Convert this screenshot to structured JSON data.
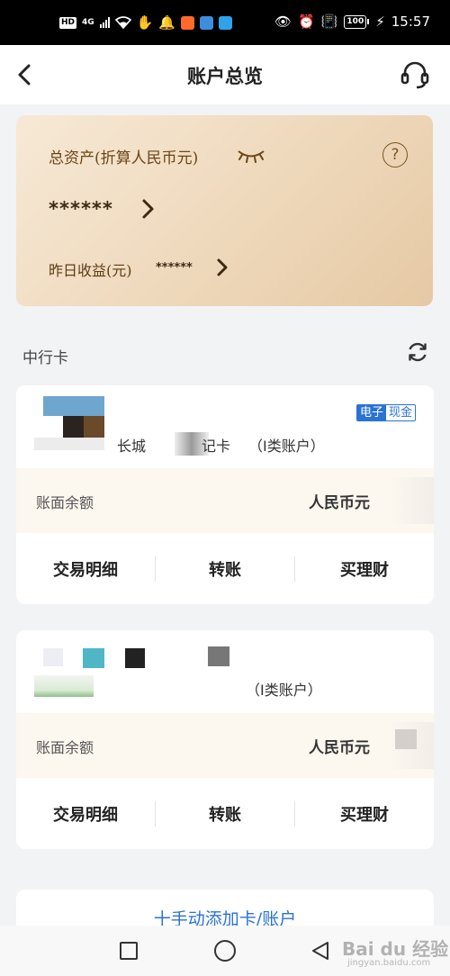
{
  "status_bar": {
    "hd": "HD",
    "network": "4G",
    "battery": "100",
    "time": "15:57"
  },
  "header": {
    "title": "账户总览"
  },
  "asset_card": {
    "total_assets_label": "总资产(折算人民币元)",
    "total_assets_value": "******",
    "yesterday_yield_label": "昨日收益(元)",
    "yesterday_yield_value": "******",
    "help_symbol": "?"
  },
  "section": {
    "title": "中行卡"
  },
  "cards": [
    {
      "name": "长城",
      "name_suffix": "记卡",
      "type": "（I类账户）",
      "badge_left": "电子",
      "badge_right": "现金",
      "balance_label": "账面余额",
      "currency": "人民币元",
      "actions": [
        "交易明细",
        "转账",
        "买理财"
      ]
    },
    {
      "type": "（I类账户）",
      "balance_label": "账面余额",
      "currency": "人民币元",
      "actions": [
        "交易明细",
        "转账",
        "买理财"
      ]
    }
  ],
  "add_card": {
    "label": "十手动添加卡/账户"
  },
  "watermark": {
    "main": "Bai du 经验",
    "sub": "jingyan.baidu.com"
  },
  "colors": {
    "accent_blue": "#2a72d4",
    "gold_text": "#6b4516",
    "card_gradient_start": "#f7e9d6",
    "card_gradient_end": "#e6c9a4"
  }
}
